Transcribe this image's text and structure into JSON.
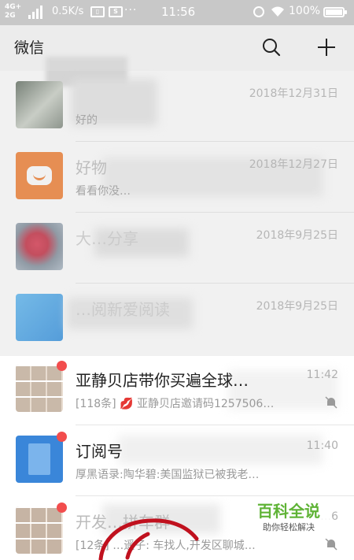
{
  "status_bar": {
    "network_top": "4G+",
    "network_bottom": "2G",
    "speed": "0.5K/s",
    "time": "11:56",
    "battery": "100%",
    "dots": "···"
  },
  "header": {
    "title": "微信"
  },
  "chats": [
    {
      "name": "",
      "preview": "好的",
      "time": "2018年12月31日"
    },
    {
      "name": "好物",
      "preview": "看看你没…",
      "time": "2018年12月27日"
    },
    {
      "name": "大…分享",
      "preview": "",
      "time": "2018年9月25日"
    },
    {
      "name": "…阅新爱阅读",
      "preview": "",
      "time": "2018年9月25日"
    },
    {
      "name": "亚静贝店带你买遍全球…",
      "preview": "[118条] 💋 亚静贝店邀请码1257506…",
      "time": "11:42"
    },
    {
      "name": "订阅号",
      "preview": "厚黑语录:陶华碧:美国监狱已被我老…",
      "time": "11:40"
    },
    {
      "name": "开发…拼车群",
      "preview": "[12条] …遥子: 车找人,开发区聊城…",
      "time": "…6"
    }
  ],
  "watermark": {
    "title": "百科全说",
    "subtitle": "助你轻松解决"
  }
}
